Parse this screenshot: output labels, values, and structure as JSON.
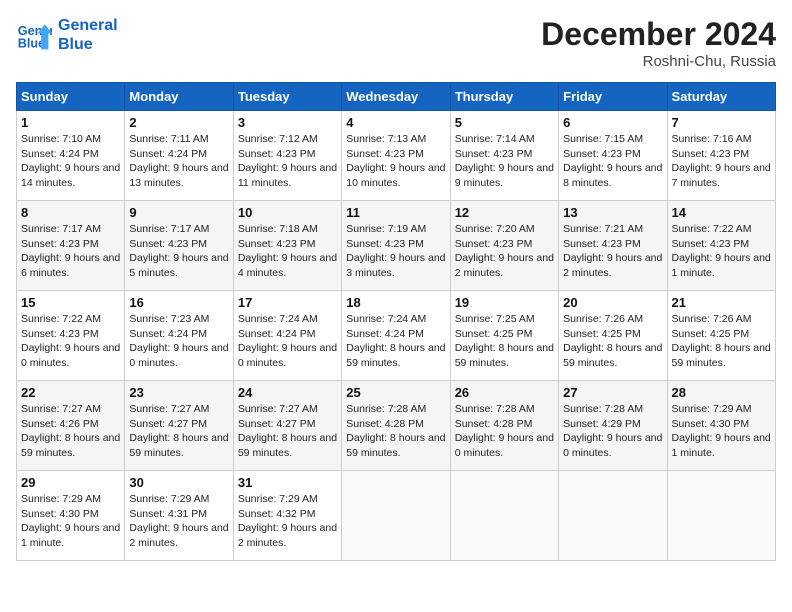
{
  "header": {
    "logo_line1": "General",
    "logo_line2": "Blue",
    "month": "December 2024",
    "location": "Roshni-Chu, Russia"
  },
  "days_of_week": [
    "Sunday",
    "Monday",
    "Tuesday",
    "Wednesday",
    "Thursday",
    "Friday",
    "Saturday"
  ],
  "weeks": [
    [
      {
        "day": "1",
        "info": "Sunrise: 7:10 AM\nSunset: 4:24 PM\nDaylight: 9 hours and 14 minutes."
      },
      {
        "day": "2",
        "info": "Sunrise: 7:11 AM\nSunset: 4:24 PM\nDaylight: 9 hours and 13 minutes."
      },
      {
        "day": "3",
        "info": "Sunrise: 7:12 AM\nSunset: 4:23 PM\nDaylight: 9 hours and 11 minutes."
      },
      {
        "day": "4",
        "info": "Sunrise: 7:13 AM\nSunset: 4:23 PM\nDaylight: 9 hours and 10 minutes."
      },
      {
        "day": "5",
        "info": "Sunrise: 7:14 AM\nSunset: 4:23 PM\nDaylight: 9 hours and 9 minutes."
      },
      {
        "day": "6",
        "info": "Sunrise: 7:15 AM\nSunset: 4:23 PM\nDaylight: 9 hours and 8 minutes."
      },
      {
        "day": "7",
        "info": "Sunrise: 7:16 AM\nSunset: 4:23 PM\nDaylight: 9 hours and 7 minutes."
      }
    ],
    [
      {
        "day": "8",
        "info": "Sunrise: 7:17 AM\nSunset: 4:23 PM\nDaylight: 9 hours and 6 minutes."
      },
      {
        "day": "9",
        "info": "Sunrise: 7:17 AM\nSunset: 4:23 PM\nDaylight: 9 hours and 5 minutes."
      },
      {
        "day": "10",
        "info": "Sunrise: 7:18 AM\nSunset: 4:23 PM\nDaylight: 9 hours and 4 minutes."
      },
      {
        "day": "11",
        "info": "Sunrise: 7:19 AM\nSunset: 4:23 PM\nDaylight: 9 hours and 3 minutes."
      },
      {
        "day": "12",
        "info": "Sunrise: 7:20 AM\nSunset: 4:23 PM\nDaylight: 9 hours and 2 minutes."
      },
      {
        "day": "13",
        "info": "Sunrise: 7:21 AM\nSunset: 4:23 PM\nDaylight: 9 hours and 2 minutes."
      },
      {
        "day": "14",
        "info": "Sunrise: 7:22 AM\nSunset: 4:23 PM\nDaylight: 9 hours and 1 minute."
      }
    ],
    [
      {
        "day": "15",
        "info": "Sunrise: 7:22 AM\nSunset: 4:23 PM\nDaylight: 9 hours and 0 minutes."
      },
      {
        "day": "16",
        "info": "Sunrise: 7:23 AM\nSunset: 4:24 PM\nDaylight: 9 hours and 0 minutes."
      },
      {
        "day": "17",
        "info": "Sunrise: 7:24 AM\nSunset: 4:24 PM\nDaylight: 9 hours and 0 minutes."
      },
      {
        "day": "18",
        "info": "Sunrise: 7:24 AM\nSunset: 4:24 PM\nDaylight: 8 hours and 59 minutes."
      },
      {
        "day": "19",
        "info": "Sunrise: 7:25 AM\nSunset: 4:25 PM\nDaylight: 8 hours and 59 minutes."
      },
      {
        "day": "20",
        "info": "Sunrise: 7:26 AM\nSunset: 4:25 PM\nDaylight: 8 hours and 59 minutes."
      },
      {
        "day": "21",
        "info": "Sunrise: 7:26 AM\nSunset: 4:25 PM\nDaylight: 8 hours and 59 minutes."
      }
    ],
    [
      {
        "day": "22",
        "info": "Sunrise: 7:27 AM\nSunset: 4:26 PM\nDaylight: 8 hours and 59 minutes."
      },
      {
        "day": "23",
        "info": "Sunrise: 7:27 AM\nSunset: 4:27 PM\nDaylight: 8 hours and 59 minutes."
      },
      {
        "day": "24",
        "info": "Sunrise: 7:27 AM\nSunset: 4:27 PM\nDaylight: 8 hours and 59 minutes."
      },
      {
        "day": "25",
        "info": "Sunrise: 7:28 AM\nSunset: 4:28 PM\nDaylight: 8 hours and 59 minutes."
      },
      {
        "day": "26",
        "info": "Sunrise: 7:28 AM\nSunset: 4:28 PM\nDaylight: 9 hours and 0 minutes."
      },
      {
        "day": "27",
        "info": "Sunrise: 7:28 AM\nSunset: 4:29 PM\nDaylight: 9 hours and 0 minutes."
      },
      {
        "day": "28",
        "info": "Sunrise: 7:29 AM\nSunset: 4:30 PM\nDaylight: 9 hours and 1 minute."
      }
    ],
    [
      {
        "day": "29",
        "info": "Sunrise: 7:29 AM\nSunset: 4:30 PM\nDaylight: 9 hours and 1 minute."
      },
      {
        "day": "30",
        "info": "Sunrise: 7:29 AM\nSunset: 4:31 PM\nDaylight: 9 hours and 2 minutes."
      },
      {
        "day": "31",
        "info": "Sunrise: 7:29 AM\nSunset: 4:32 PM\nDaylight: 9 hours and 2 minutes."
      },
      null,
      null,
      null,
      null
    ]
  ]
}
